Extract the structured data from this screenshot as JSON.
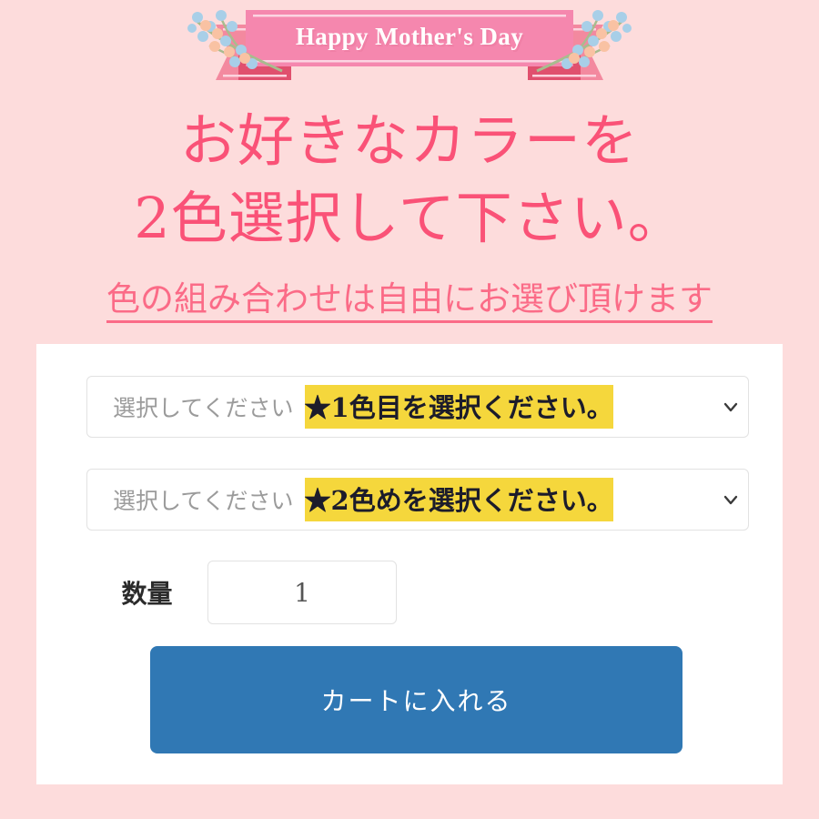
{
  "banner": {
    "title": "Happy Mother's Day",
    "ribbon_color": "#f587ae",
    "ribbon_tail_color": "#f3899f",
    "ribbon_shadow_color": "#e0506e",
    "flower_blue": "#a8cfe8",
    "flower_peach": "#f9c2a3",
    "stem_green": "#a8bc8e"
  },
  "page": {
    "background_color": "#fddcdc",
    "heading_color": "#fa5277",
    "card_background": "#ffffff"
  },
  "headline": {
    "line1": "お好きなカラーを",
    "line2": "2色選択して下さい。"
  },
  "subheadline": {
    "text": "色の組み合わせは自由にお選び頂けます"
  },
  "form": {
    "select_1": {
      "placeholder": "選択してください",
      "highlight_label": "★1色目を選択ください。",
      "highlight_color": "#f5d73c",
      "chevron": "chevron-down-icon"
    },
    "select_2": {
      "placeholder": "選択してください",
      "highlight_label": "★2色めを選択ください。",
      "highlight_color": "#f5d73c",
      "chevron": "chevron-down-icon"
    },
    "quantity": {
      "label": "数量",
      "value": "1"
    },
    "cart_button": {
      "label": "カートに入れる",
      "color": "#3078b4"
    }
  }
}
